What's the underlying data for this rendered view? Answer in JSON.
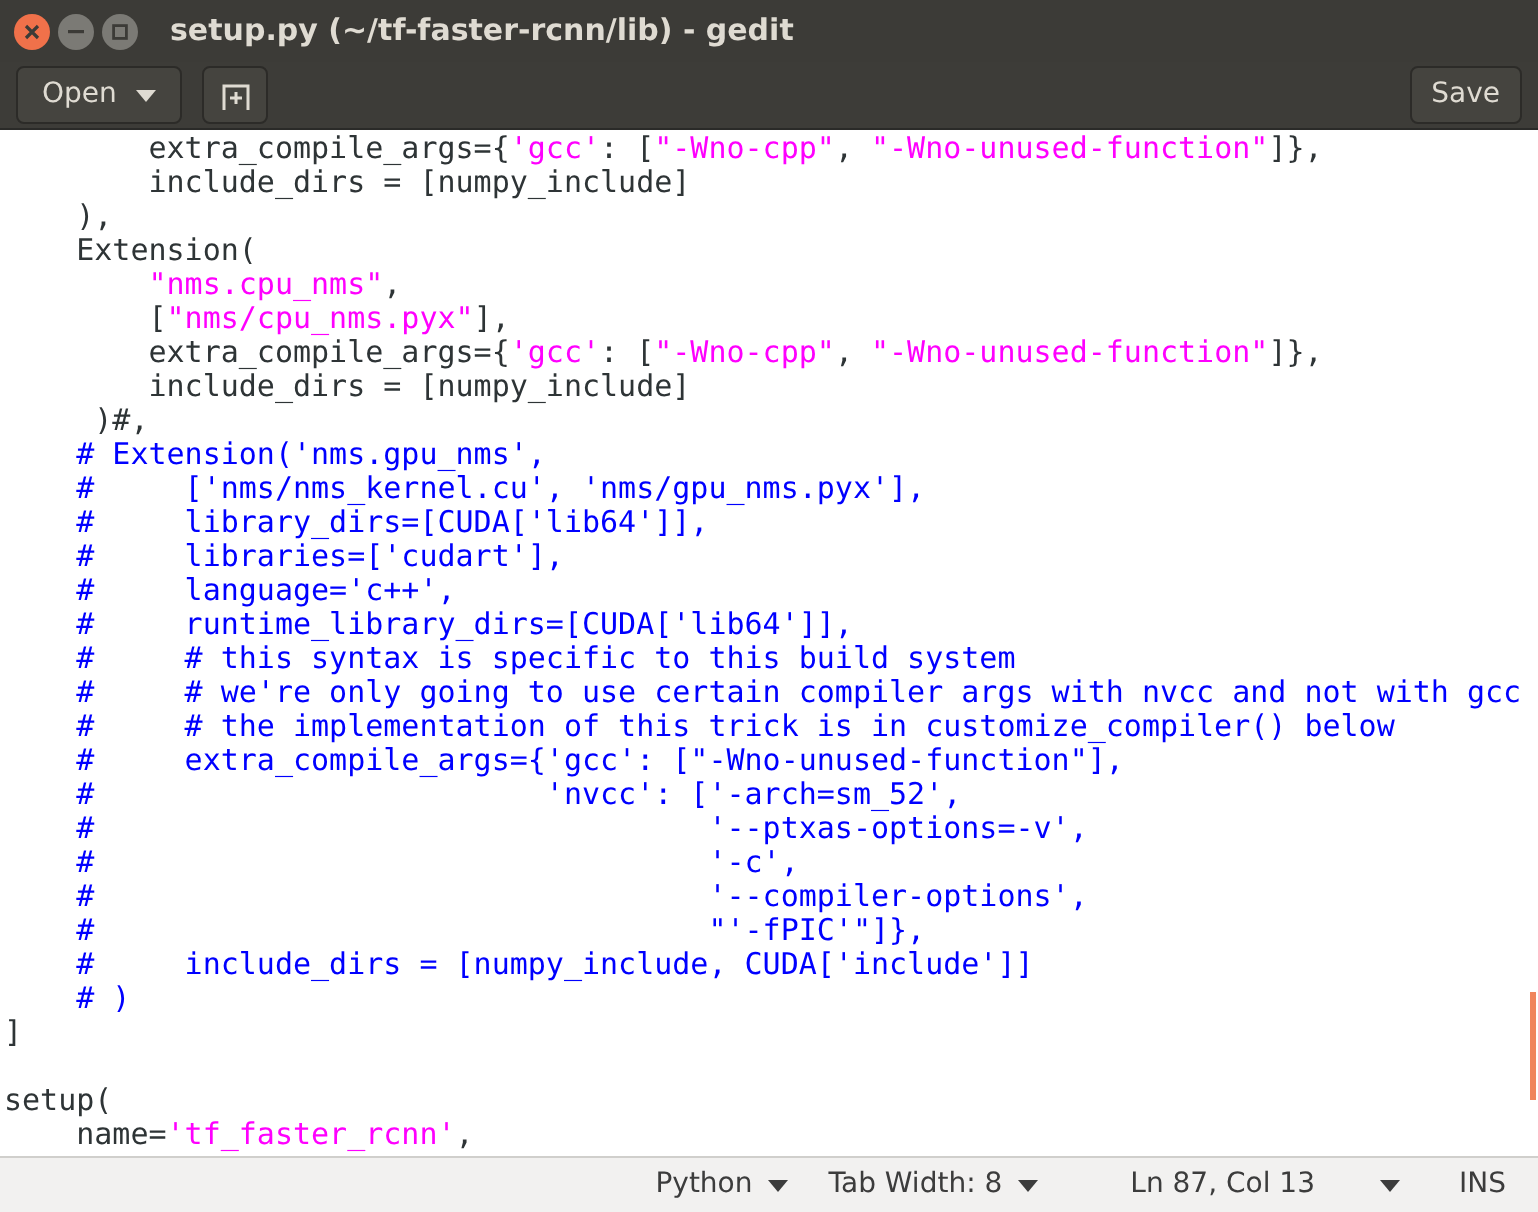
{
  "window": {
    "title": "setup.py (~/tf-faster-rcnn/lib) - gedit"
  },
  "toolbar": {
    "open_button": "Open",
    "save_button": "Save"
  },
  "editor": {
    "lines": [
      [
        {
          "kind": "p",
          "text": "        extra_compile_args={"
        },
        {
          "kind": "s",
          "text": "'gcc'"
        },
        {
          "kind": "p",
          "text": ": ["
        },
        {
          "kind": "s",
          "text": "\"-Wno-cpp\""
        },
        {
          "kind": "p",
          "text": ", "
        },
        {
          "kind": "s",
          "text": "\"-Wno-unused-function\""
        },
        {
          "kind": "p",
          "text": "]},"
        }
      ],
      [
        {
          "kind": "p",
          "text": "        include_dirs = [numpy_include]"
        }
      ],
      [
        {
          "kind": "p",
          "text": "    ),"
        }
      ],
      [
        {
          "kind": "p",
          "text": "    Extension("
        }
      ],
      [
        {
          "kind": "s",
          "text": "        \"nms.cpu_nms\""
        },
        {
          "kind": "p",
          "text": ","
        }
      ],
      [
        {
          "kind": "p",
          "text": "        ["
        },
        {
          "kind": "s",
          "text": "\"nms/cpu_nms.pyx\""
        },
        {
          "kind": "p",
          "text": "],"
        }
      ],
      [
        {
          "kind": "p",
          "text": "        extra_compile_args={"
        },
        {
          "kind": "s",
          "text": "'gcc'"
        },
        {
          "kind": "p",
          "text": ": ["
        },
        {
          "kind": "s",
          "text": "\"-Wno-cpp\""
        },
        {
          "kind": "p",
          "text": ", "
        },
        {
          "kind": "s",
          "text": "\"-Wno-unused-function\""
        },
        {
          "kind": "p",
          "text": "]},"
        }
      ],
      [
        {
          "kind": "p",
          "text": "        include_dirs = [numpy_include]"
        }
      ],
      [
        {
          "kind": "p",
          "text": "     )#,"
        }
      ],
      [
        {
          "kind": "c",
          "text": "    # Extension('nms.gpu_nms',"
        }
      ],
      [
        {
          "kind": "c",
          "text": "    #     ['nms/nms_kernel.cu', 'nms/gpu_nms.pyx'],"
        }
      ],
      [
        {
          "kind": "c",
          "text": "    #     library_dirs=[CUDA['lib64']],"
        }
      ],
      [
        {
          "kind": "c",
          "text": "    #     libraries=['cudart'],"
        }
      ],
      [
        {
          "kind": "c",
          "text": "    #     language='c++',"
        }
      ],
      [
        {
          "kind": "c",
          "text": "    #     runtime_library_dirs=[CUDA['lib64']],"
        }
      ],
      [
        {
          "kind": "c",
          "text": "    #     # this syntax is specific to this build system"
        }
      ],
      [
        {
          "kind": "c",
          "text": "    #     # we're only going to use certain compiler args with nvcc and not with gcc"
        }
      ],
      [
        {
          "kind": "c",
          "text": "    #     # the implementation of this trick is in customize_compiler() below"
        }
      ],
      [
        {
          "kind": "c",
          "text": "    #     extra_compile_args={'gcc': [\"-Wno-unused-function\"],"
        }
      ],
      [
        {
          "kind": "c",
          "text": "    #                         'nvcc': ['-arch=sm_52',"
        }
      ],
      [
        {
          "kind": "c",
          "text": "    #                                  '--ptxas-options=-v',"
        }
      ],
      [
        {
          "kind": "c",
          "text": "    #                                  '-c',"
        }
      ],
      [
        {
          "kind": "c",
          "text": "    #                                  '--compiler-options',"
        }
      ],
      [
        {
          "kind": "c",
          "text": "    #                                  \"'-fPIC'\"]},"
        }
      ],
      [
        {
          "kind": "c",
          "text": "    #     include_dirs = [numpy_include, CUDA['include']]"
        }
      ],
      [
        {
          "kind": "c",
          "text": "    # )"
        }
      ],
      [
        {
          "kind": "p",
          "text": "]"
        }
      ],
      [
        {
          "kind": "blank"
        }
      ],
      [
        {
          "kind": "p",
          "text": "setup("
        }
      ],
      [
        {
          "kind": "p",
          "text": "    name="
        },
        {
          "kind": "s",
          "text": "'tf_faster_rcnn'"
        },
        {
          "kind": "p",
          "text": ","
        }
      ]
    ]
  },
  "status_bar": {
    "language": "Python",
    "tab_width": "Tab Width: 8",
    "position": "Ln 87, Col 13",
    "mode": "INS"
  }
}
